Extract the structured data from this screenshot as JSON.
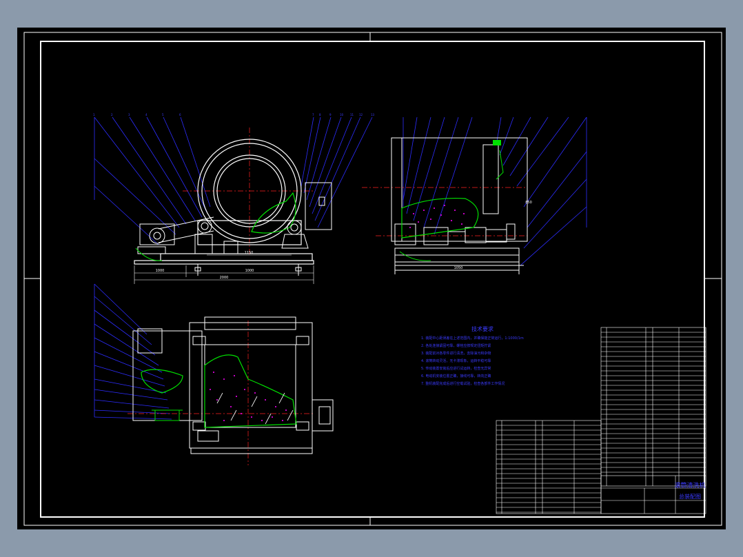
{
  "canvas": {
    "background": "#000000",
    "outer_background": "#8b9aab",
    "border_color": "#ffffff",
    "colors": {
      "geometry": "#ffffff",
      "leader": "#2d2dff",
      "text_blue": "#3b3bff",
      "centerline": "#ff2020",
      "material": "#00e000",
      "particles": "#ff00ff"
    }
  },
  "technical_requirements": {
    "title": "技术要求",
    "items": [
      "1. 装配中心距误差在上述范围内，并确保能正常运行，1:1000/1m",
      "2. 各处连接紧固可靠，螺栓应按规定扭矩拧紧",
      "3. 装配前对各零件进行清洗，去除油污和杂物",
      "4. 滚筒转动灵活，无卡滞现象，运转平稳可靠",
      "5. 传动装置安装后应进行试运转，检查无异常",
      "6. 电动机安装位置正确，接线可靠，转向正确",
      "7. 整机装配完成后进行空载试验，检查各部件工作情况"
    ]
  },
  "title_block": {
    "drawing_name": "滚筒清洗机",
    "drawing_type": "总装配图"
  },
  "dimensions": {
    "front_left": "1000",
    "front_right": "1000",
    "front_total": "2000",
    "front_inner": "1150",
    "side_width": "1050",
    "side_right": "850"
  }
}
